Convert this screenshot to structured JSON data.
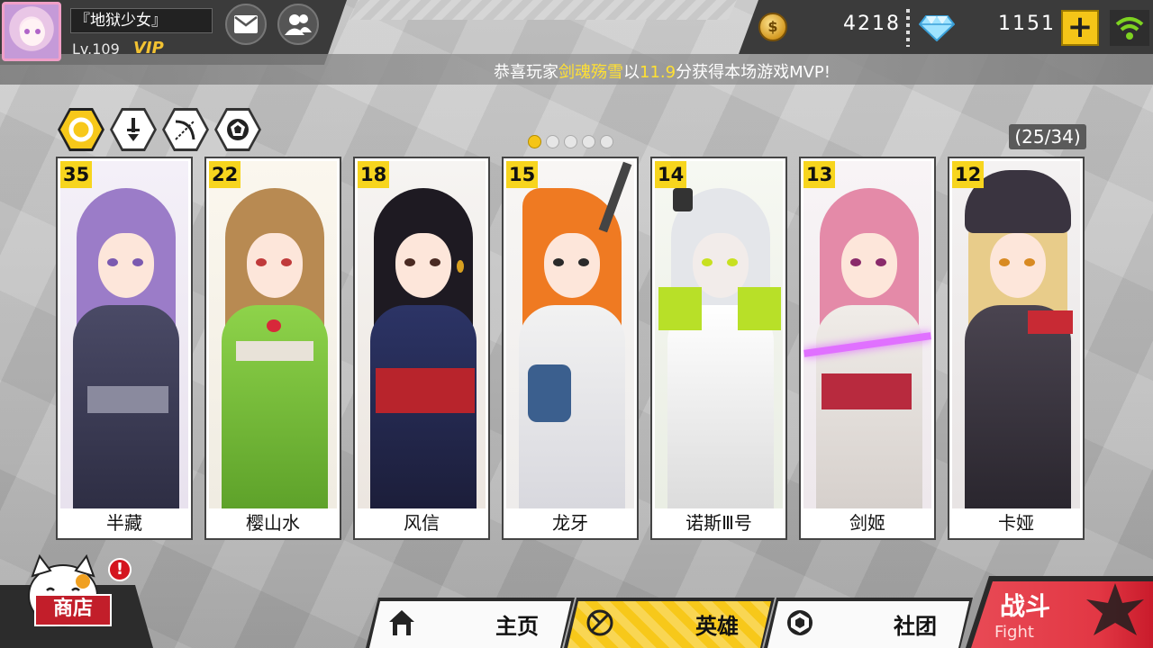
{
  "player": {
    "name": "『地狱少女』",
    "level": "Lv.109",
    "vip": "VIP"
  },
  "currency": {
    "gold": "4218",
    "gems": "1151",
    "coin_symbol": "$",
    "add_label": "+"
  },
  "icons": {
    "mail": "mail-icon",
    "friends": "friends-icon",
    "wifi": "wifi-icon",
    "gem": "diamond-icon"
  },
  "notice": {
    "prefix": "恭喜玩家",
    "player": "剑魂殇雪",
    "middle": "以",
    "score": "11.9",
    "suffix": "分获得本场游戏MVP!"
  },
  "filters": [
    {
      "id": "all",
      "icon": "ring-icon",
      "active": true
    },
    {
      "id": "melee",
      "icon": "sword-icon",
      "active": false
    },
    {
      "id": "ranged",
      "icon": "bow-icon",
      "active": false
    },
    {
      "id": "support",
      "icon": "shield-icon",
      "active": false
    }
  ],
  "pager": {
    "total_pages": 5,
    "current_page": 1,
    "count": "(25/34)"
  },
  "heroes": [
    {
      "level": "35",
      "name": "半藏"
    },
    {
      "level": "22",
      "name": "樱山水"
    },
    {
      "level": "18",
      "name": "风信"
    },
    {
      "level": "15",
      "name": "龙牙"
    },
    {
      "level": "14",
      "name": "诺斯Ⅲ号"
    },
    {
      "level": "13",
      "name": "剑姬"
    },
    {
      "level": "12",
      "name": "卡娅"
    }
  ],
  "shop": {
    "label": "商店",
    "alert": "!"
  },
  "nav": {
    "home": "主页",
    "heroes": "英雄",
    "club": "社团",
    "fight_cn": "战斗",
    "fight_en": "Fight"
  },
  "colors": {
    "accent": "#f7c81a",
    "highlight_text": "#ffe033",
    "fight": "#e23744",
    "top_bar": "#3b3b3b"
  }
}
